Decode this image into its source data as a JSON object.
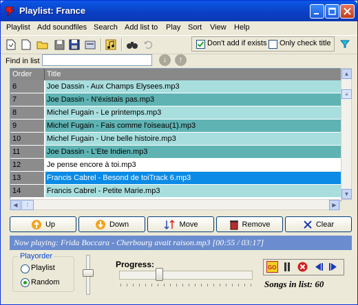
{
  "window": {
    "title": "Playlist: France"
  },
  "menu": [
    {
      "label": "Playlist"
    },
    {
      "label": "Add soundfiles"
    },
    {
      "label": "Search"
    },
    {
      "label": "Add list to"
    },
    {
      "label": "Play"
    },
    {
      "label": "Sort"
    },
    {
      "label": "View"
    },
    {
      "label": "Help"
    }
  ],
  "toolbar_icons": [
    "new-playlist-icon",
    "new-file-icon",
    "open-folder-icon",
    "save-icon",
    "save-as-icon",
    "properties-icon",
    "add-music-icon",
    "find-icon",
    "undo-icon"
  ],
  "options": {
    "dont_add_if_exists": {
      "label": "Don't add if exists",
      "checked": true
    },
    "only_check_title": {
      "label": "Only check title",
      "checked": false
    }
  },
  "find": {
    "label": "Find in list",
    "value": ""
  },
  "table": {
    "headers": {
      "order": "Order",
      "title": "Title"
    },
    "rows": [
      {
        "order": "6",
        "title": "Joe Dassin - Aux Champs Elysees.mp3",
        "style": "b"
      },
      {
        "order": "7",
        "title": "Joe Dassin - N'éxistais pas.mp3",
        "style": "a"
      },
      {
        "order": "8",
        "title": "Michel Fugain - Le printemps.mp3",
        "style": "b"
      },
      {
        "order": "9",
        "title": "Michel Fugain - Fais comme l'oiseau(1).mp3",
        "style": "a"
      },
      {
        "order": "10",
        "title": "Michel Fugain - Une belle histoire.mp3",
        "style": "b"
      },
      {
        "order": "11",
        "title": "Joe Dassin - L'Ete Indien.mp3",
        "style": "a"
      },
      {
        "order": "12",
        "title": "Je pense encore à toi.mp3",
        "style": "w"
      },
      {
        "order": "13",
        "title": "Francis Cabrel - Besond de toiTrack  6.mp3",
        "style": "sel"
      },
      {
        "order": "14",
        "title": "Francis Cabrel - Petite Marie.mp3",
        "style": "b"
      }
    ]
  },
  "buttons": {
    "up": "Up",
    "down": "Down",
    "move": "Move",
    "remove": "Remove",
    "clear": "Clear"
  },
  "now_playing": "Now playing: Frida Boccara - Cherbourg avait raison.mp3    [00:55 / 03:17]",
  "playorder": {
    "label": "Playorder",
    "options": [
      "Playlist",
      "Random"
    ],
    "selected": "Random"
  },
  "progress": {
    "label": "Progress:",
    "fraction": 0.29
  },
  "volume": {
    "fraction": 0.45
  },
  "songs_in_list": "Songs in list: 60",
  "colors": {
    "row_dark": "#5fb3b3",
    "row_light": "#a8dede",
    "selected": "#0b8be6",
    "now_playing_bar": "#6b8cce"
  }
}
